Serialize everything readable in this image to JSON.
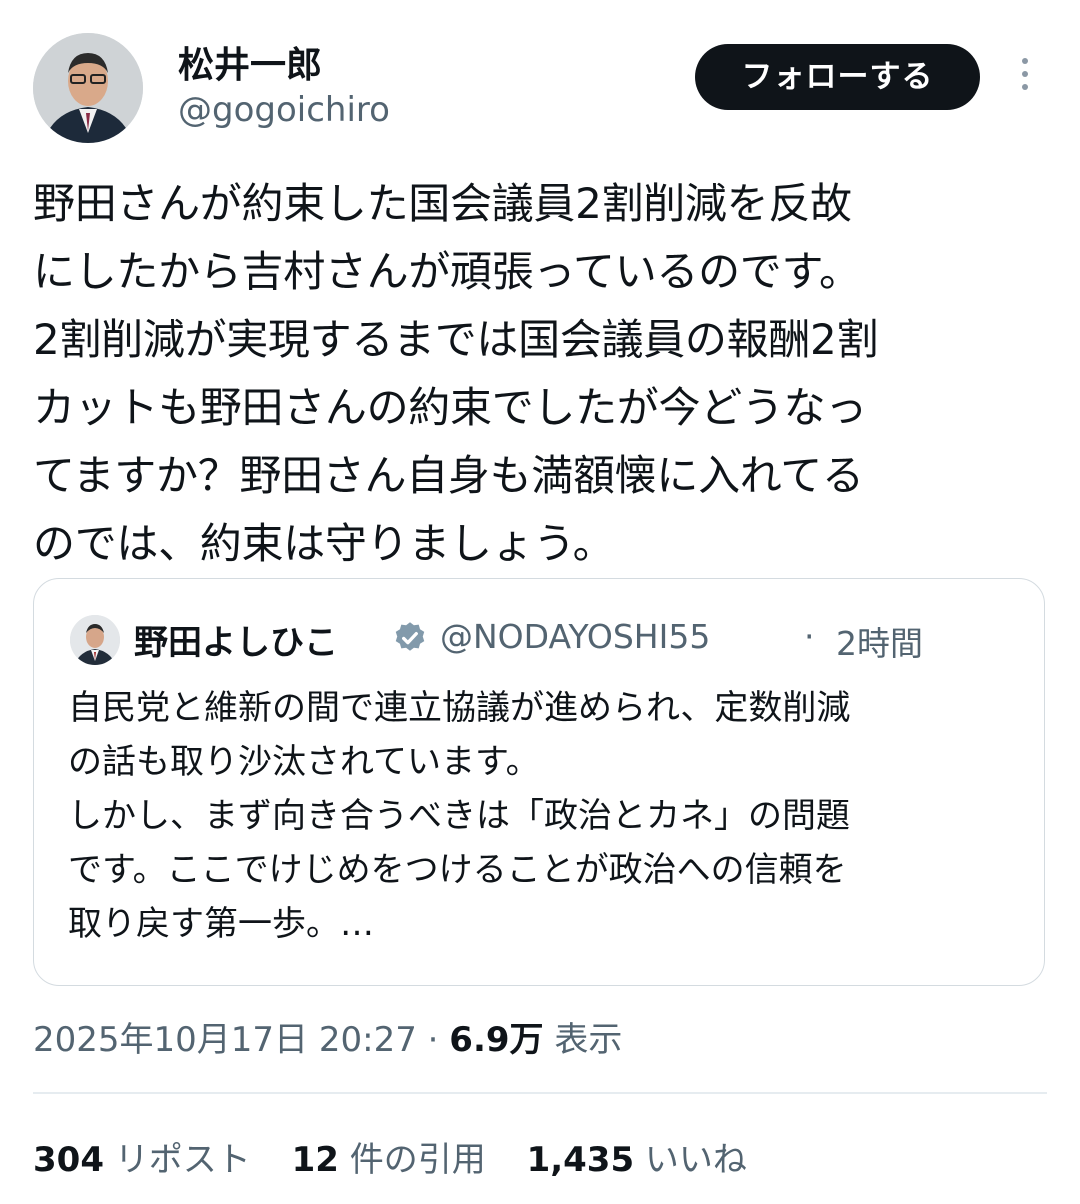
{
  "author": {
    "name": "松井一郎",
    "handle": "@gogoichiro",
    "follow_label": "フォローする"
  },
  "tweet": {
    "text": "野田さんが約束した国会議員2割削減を反故\nにしたから吉村さんが頑張っているのです。\n2割削減が実現するまでは国会議員の報酬2割\nカットも野田さんの約束でしたが今どうなっ\nてますか？野田さん自身も満額懐に入れてる\nのでは、約束は守りましょう。"
  },
  "quote": {
    "name": "野田よしひこ",
    "handle": "@NODAYOSHI55",
    "separator": "·",
    "time": "2時間",
    "text": "自民党と維新の間で連立協議が進められ、定数削減\nの話も取り沙汰されています。\nしかし、まず向き合うべきは「政治とカネ」の問題\nです。ここでけじめをつけることが政治への信頼を\n取り戻す第一歩。…",
    "verified_color": "#829aab"
  },
  "meta": {
    "datetime": "2025年10月17日 20:27",
    "separator": "·",
    "views_count": "6.9万",
    "views_label": "表示"
  },
  "stats": {
    "reposts_count": "304",
    "reposts_label": "リポスト",
    "quotes_count": "12",
    "quotes_label": "件の引用",
    "likes_count": "1,435",
    "likes_label": "いいね"
  }
}
